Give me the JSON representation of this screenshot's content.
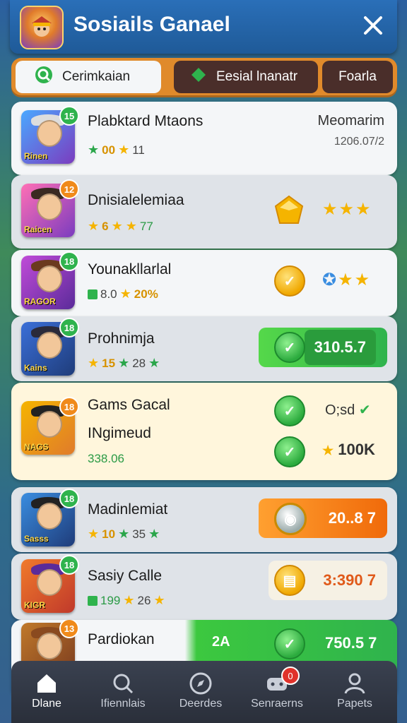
{
  "header": {
    "title": "Sosiails Ganael",
    "app_icon": "game-character-icon",
    "close_icon": "close-icon"
  },
  "tabs": [
    {
      "label": "Cerimkaian",
      "icon": "search-icon",
      "active": true
    },
    {
      "label": "Eesial lnanatr",
      "icon": "gift-icon",
      "active": false
    },
    {
      "label": "Foarla",
      "active": false
    }
  ],
  "rows": [
    {
      "name": "Plabktard Mtaons",
      "badge": "15",
      "avatar_label": "Rinen",
      "stat1": "00",
      "stat2": "11",
      "right_title": "Meomarim",
      "right_sub": "1206.07/2"
    },
    {
      "name": "Dnisialelemiaa",
      "badge": "12",
      "avatar_label": "Raicen",
      "stat1": "6",
      "stat2": "77"
    },
    {
      "name": "Younakllarlal",
      "badge": "18",
      "avatar_label": "RAGOR",
      "stat1": "8.0",
      "stat2": "20%"
    },
    {
      "name": "Prohnimja",
      "badge": "18",
      "avatar_label": "Kains",
      "stat1": "15",
      "stat2": "28",
      "right_value": "310.5.7"
    },
    {
      "name": "Gams Gacal",
      "subname": "INgimeud",
      "badge": "18",
      "avatar_label": "NAGS",
      "value": "338.06",
      "right_top": "O;sd",
      "right_bottom": "100K"
    },
    {
      "name": "Madinlemiat",
      "badge": "18",
      "avatar_label": "Sasss",
      "stat1": "10",
      "stat2": "35",
      "right_value": "20..8 7"
    },
    {
      "name": "Sasiy Calle",
      "badge": "18",
      "avatar_label": "KIGR",
      "stat1": "199",
      "stat2": "26",
      "right_value": "3:390 7"
    },
    {
      "name": "Pardiokan",
      "badge": "13",
      "left_value": "2A",
      "right_value": "750.5 7"
    }
  ],
  "bottom_nav": [
    {
      "label": "Dlane",
      "icon": "home-icon",
      "active": true
    },
    {
      "label": "Ifiennlais",
      "icon": "search-icon"
    },
    {
      "label": "Deerdes",
      "icon": "compass-icon"
    },
    {
      "label": "Senraerns",
      "icon": "gamepad-icon",
      "notification": "0"
    },
    {
      "label": "Papets",
      "icon": "profile-icon"
    }
  ],
  "colors": {
    "header_blue": "#2a6fb8",
    "tab_orange": "#e08a2b",
    "green_pill": "#3cc83f",
    "orange_pill": "#f37a12",
    "star_yellow": "#f5b400",
    "star_green": "#2aa64a"
  }
}
